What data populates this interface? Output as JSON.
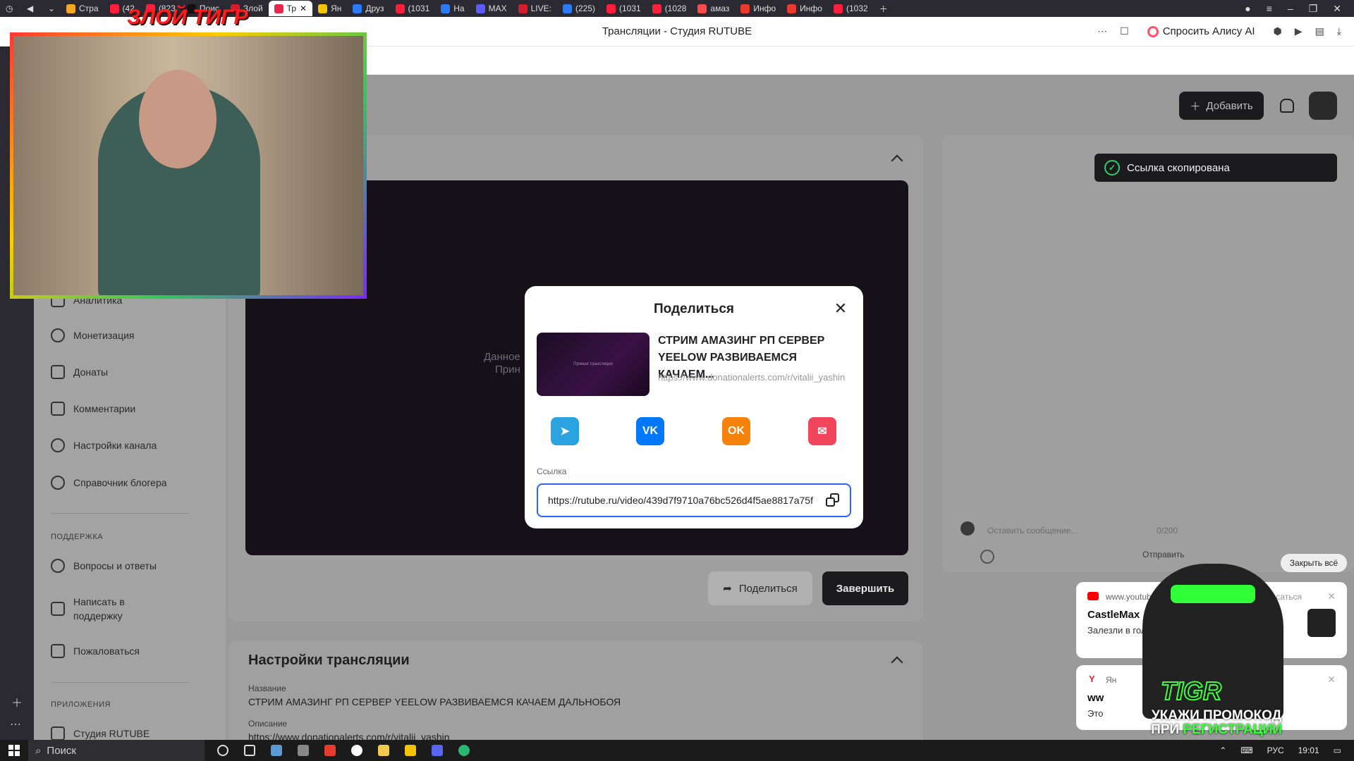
{
  "browser": {
    "tabs": [
      {
        "label": "Стра",
        "color": "#f5a623",
        "active": false
      },
      {
        "label": "(42",
        "color": "#ff1e3c",
        "active": false
      },
      {
        "label": "(823",
        "color": "#ff1e3c",
        "active": false
      },
      {
        "label": "Поис",
        "color": "#111111",
        "active": false
      },
      {
        "label": "Злой",
        "color": "#d81b2c",
        "active": false
      },
      {
        "label": "Тр",
        "color": "#e6284d",
        "active": true
      },
      {
        "label": "Ян",
        "color": "#f5c400",
        "active": false
      },
      {
        "label": "Друз",
        "color": "#2a7bf5",
        "active": false
      },
      {
        "label": "(1031",
        "color": "#ff1e3c",
        "active": false
      },
      {
        "label": "На",
        "color": "#2a7bf5",
        "active": false
      },
      {
        "label": "MAX",
        "color": "#5b5bff",
        "active": false
      },
      {
        "label": "LIVE:",
        "color": "#d81b2c",
        "active": false
      },
      {
        "label": "(225)",
        "color": "#2a7bf5",
        "active": false
      },
      {
        "label": "(1031",
        "color": "#ff1e3c",
        "active": false
      },
      {
        "label": "(1028",
        "color": "#ff1e3c",
        "active": false
      },
      {
        "label": "амаз",
        "color": "#ff4a4a",
        "active": false
      },
      {
        "label": "Инфо",
        "color": "#e63b2e",
        "active": false
      },
      {
        "label": "Инфо",
        "color": "#e63b2e",
        "active": false
      },
      {
        "label": "(1032",
        "color": "#ff1e3c",
        "active": false
      }
    ],
    "page_title": "Трансляции - Студия RUTUBE",
    "alice_label": "Спросить Алису AI"
  },
  "header": {
    "add_label": "Добавить"
  },
  "toast": {
    "text": "Ссылка скопирована"
  },
  "sidebar": {
    "items": [
      {
        "label": "Аналитика"
      },
      {
        "label": "Монетизация"
      },
      {
        "label": "Донаты"
      },
      {
        "label": "Комментарии"
      },
      {
        "label": "Настройки канала"
      },
      {
        "label": "Справочник блогера"
      }
    ],
    "support_heading": "ПОДДЕРЖКА",
    "support_items": [
      {
        "label": "Вопросы и ответы"
      },
      {
        "label": "Написать в поддержку"
      },
      {
        "label": "Пожаловаться"
      }
    ],
    "apps_heading": "ПРИЛОЖЕНИЯ",
    "apps_items": [
      {
        "label": "Студия RUTUBE"
      }
    ]
  },
  "player": {
    "text_line1": "Данное",
    "text_line2": "Прин"
  },
  "actions": {
    "share_label": "Поделиться",
    "finish_label": "Завершить"
  },
  "settings": {
    "title": "Настройки трансляции",
    "name_label": "Название",
    "name_value": "СТРИМ АМАЗИНГ РП СЕРВЕР YEELOW РАЗВИВАЕМСЯ КАЧАЕМ ДАЛЬНОБОЯ",
    "desc_label": "Описание",
    "desc_value": "https://www.donationalerts.com/r/vitalii_yashin"
  },
  "chat": {
    "placeholder": "Оставить сообщение...",
    "counter": "0/200",
    "send_label": "Отправить"
  },
  "modal": {
    "title": "Поделиться",
    "video_title": "СТРИМ АМАЗИНГ РП СЕРВЕР YEELOW РАЗВИВАЕМСЯ КАЧАЕМ...",
    "video_desc": "https://www.donationalerts.com/r/vitalii_yashin",
    "thumb_caption": "Прямая трансляция",
    "socials": [
      {
        "name": "telegram",
        "color": "#2aa3e0",
        "glyph": "➤"
      },
      {
        "name": "vk",
        "color": "#0077ff",
        "glyph": "VK"
      },
      {
        "name": "odnoklassniki",
        "color": "#f5820a",
        "glyph": "OK"
      },
      {
        "name": "email",
        "color": "#f0455b",
        "glyph": "✉"
      }
    ],
    "link_label": "Ссылка",
    "link_value": "https://rutube.ru/video/439d7f9710a76bc526d4f5ae8817a75f"
  },
  "overlay": {
    "streamer_name": "ЗЛОЙ ТИГР",
    "promo_word": "TIGR",
    "promo_line1": "УКАЖИ ПРОМОКОД",
    "promo_line2a": "ПРИ ",
    "promo_line2b": "РЕГИСТРАЦИИ"
  },
  "notifications": {
    "close_all": "Закрыть всё",
    "items": [
      {
        "source": "www.youtub",
        "unsubscribe": "Отписаться",
        "title": "CastleMax",
        "body": "Залезли в голову к Ха Chapter 5 № 3"
      },
      {
        "source": "Ян",
        "unsubscribe": "",
        "title": "ww",
        "body": "Это"
      }
    ]
  },
  "taskbar": {
    "search_label": "Поиск",
    "lang": "РУС",
    "time": "19:01"
  }
}
